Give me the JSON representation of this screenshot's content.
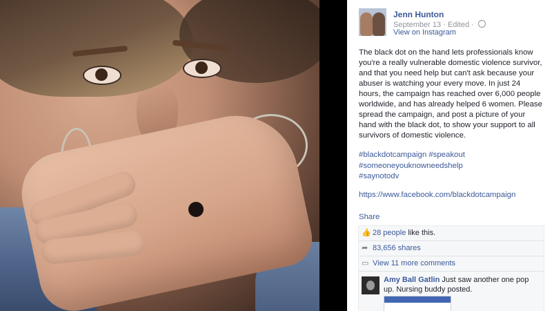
{
  "post": {
    "author": "Jenn Hunton",
    "date": "September 13",
    "edited": "Edited",
    "via": "View on Instagram",
    "text": "The black dot on the hand lets professionals know you're a really vulnerable domestic violence survivor, and that you need help but can't ask because your abuser is watching your every move. In just 24 hours, the campaign has reached over 6,000 people worldwide, and has already helped 6 women. Please spread the campaign, and post a picture of your hand with the black dot, to show your support to all survivors of domestic violence.",
    "hashtags": [
      "#blackdotcampaign #speakout",
      "#someoneyouknowneedshelp",
      "#saynotodv"
    ],
    "link": "https://www.facebook.com/blackdotcampaign",
    "share_label": "Share"
  },
  "ufi": {
    "likes_count": "28 people",
    "likes_suffix": " like this.",
    "shares": "83,656 shares",
    "view_comments": "View 11 more comments"
  },
  "comment": {
    "author": "Amy Ball Gatlin",
    "text": " Just saw another one pop up. Nursing buddy posted."
  },
  "icons": {
    "like": "thumbs-up-icon",
    "share": "share-arrow-icon",
    "comment": "speech-bubble-icon",
    "privacy": "globe-icon"
  },
  "colors": {
    "link_blue": "#3b5998",
    "text": "#1d2129",
    "meta_gray": "#90949c",
    "ufi_bg": "#f6f7f9"
  }
}
